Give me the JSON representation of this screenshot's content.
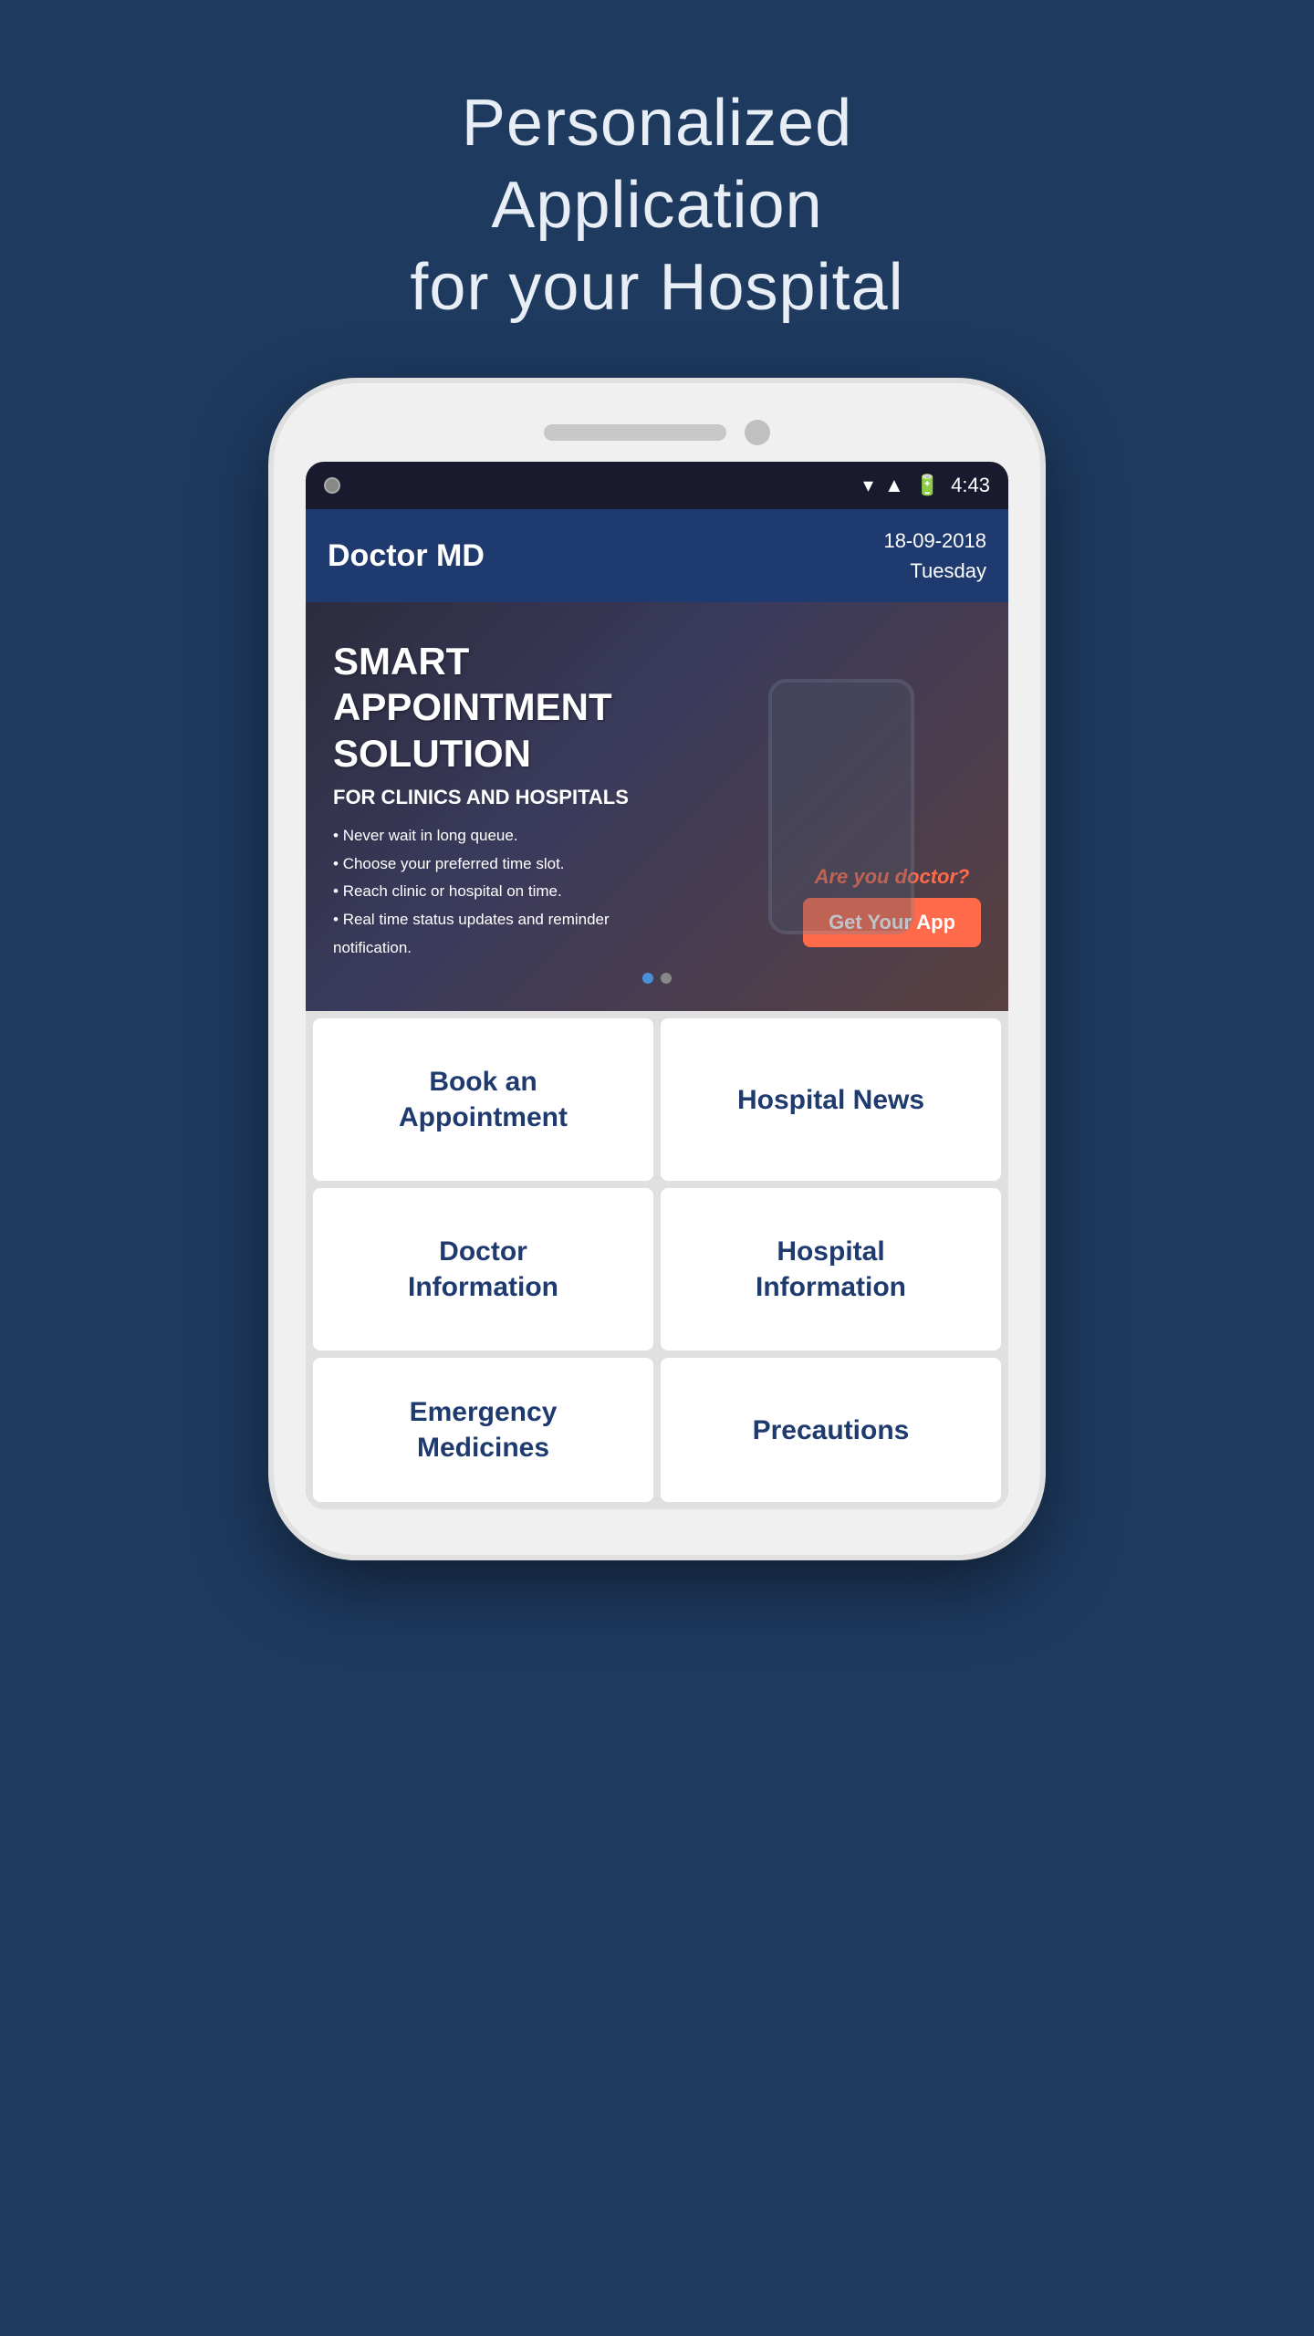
{
  "page": {
    "background_color": "#1e3a5f",
    "header": {
      "line1": "Personalized Application",
      "line2": "for your Hospital"
    }
  },
  "status_bar": {
    "time": "4:43",
    "icons": [
      "wifi",
      "signal",
      "battery"
    ]
  },
  "app_header": {
    "title": "Doctor MD",
    "date_line1": "18-09-2018",
    "date_line2": "Tuesday"
  },
  "banner": {
    "title": "SMART APPOINTMENT SOLUTION",
    "subtitle": "FOR CLINICS AND HOSPITALS",
    "bullets": [
      "Never wait in long queue.",
      "Choose your preferred time slot.",
      "Reach clinic or hospital on time.",
      "Real time status updates and reminder notification."
    ],
    "cta_question": "Are you doctor?",
    "cta_button": "Get Your App",
    "dots": [
      "active",
      "inactive"
    ]
  },
  "menu": {
    "items": [
      {
        "label": "Book an\nAppointment",
        "id": "book-appointment"
      },
      {
        "label": "Hospital News",
        "id": "hospital-news"
      },
      {
        "label": "Doctor\nInformation",
        "id": "doctor-information"
      },
      {
        "label": "Hospital\nInformation",
        "id": "hospital-information"
      },
      {
        "label": "Emergency\nMedicines",
        "id": "emergency-medicines"
      },
      {
        "label": "Precautions",
        "id": "precautions"
      }
    ]
  }
}
